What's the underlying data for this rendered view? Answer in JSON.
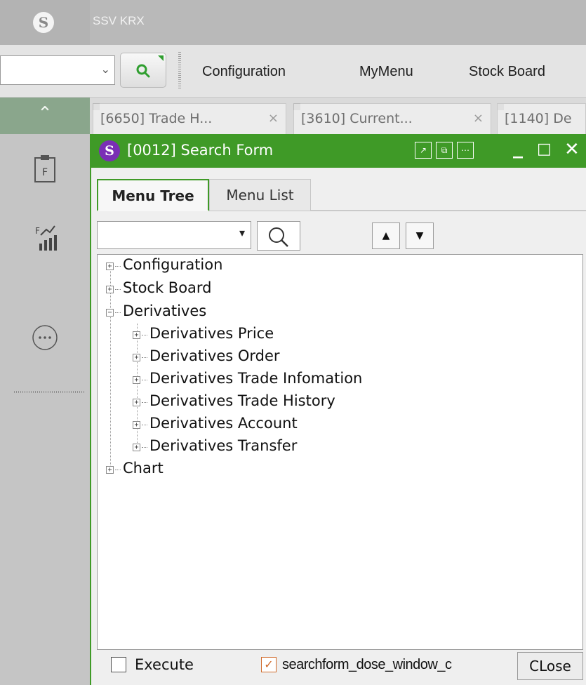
{
  "app": {
    "title": "SSV KRX",
    "logo_icon": "ssv-logo-icon"
  },
  "menubar": {
    "combo_value": "",
    "items": [
      "Configuration",
      "MyMenu",
      "Stock Board"
    ]
  },
  "sidebar": {
    "icons": [
      "clipboard-f-icon",
      "chart-f-icon",
      "more-circle-icon"
    ]
  },
  "tabs": [
    {
      "label": "[6650] Trade H...",
      "close": "×"
    },
    {
      "label": "[3610] Current...",
      "close": "×"
    },
    {
      "label": "[1140] De"
    }
  ],
  "form": {
    "title": "[0012] Search Form",
    "accent_color": "#3f9a27",
    "inner_tabs": [
      "Menu Tree",
      "Menu List"
    ],
    "search_value": "",
    "up_arrow": "▲",
    "down_arrow": "▼",
    "tree": [
      {
        "label": "Configuration",
        "expanded": false
      },
      {
        "label": "Stock Board",
        "expanded": false
      },
      {
        "label": "Derivatives",
        "expanded": true,
        "children": [
          "Derivatives Price",
          "Derivatives Order",
          "Derivatives Trade Infomation",
          "Derivatives Trade History",
          "Derivatives Account",
          "Derivatives Transfer"
        ]
      },
      {
        "label": "Chart",
        "expanded": false
      }
    ],
    "execute_label": "Execute",
    "execute_checked": false,
    "close_window_label": "searchform_dose_window_c",
    "close_window_checked": true,
    "close_button": "CLose"
  }
}
